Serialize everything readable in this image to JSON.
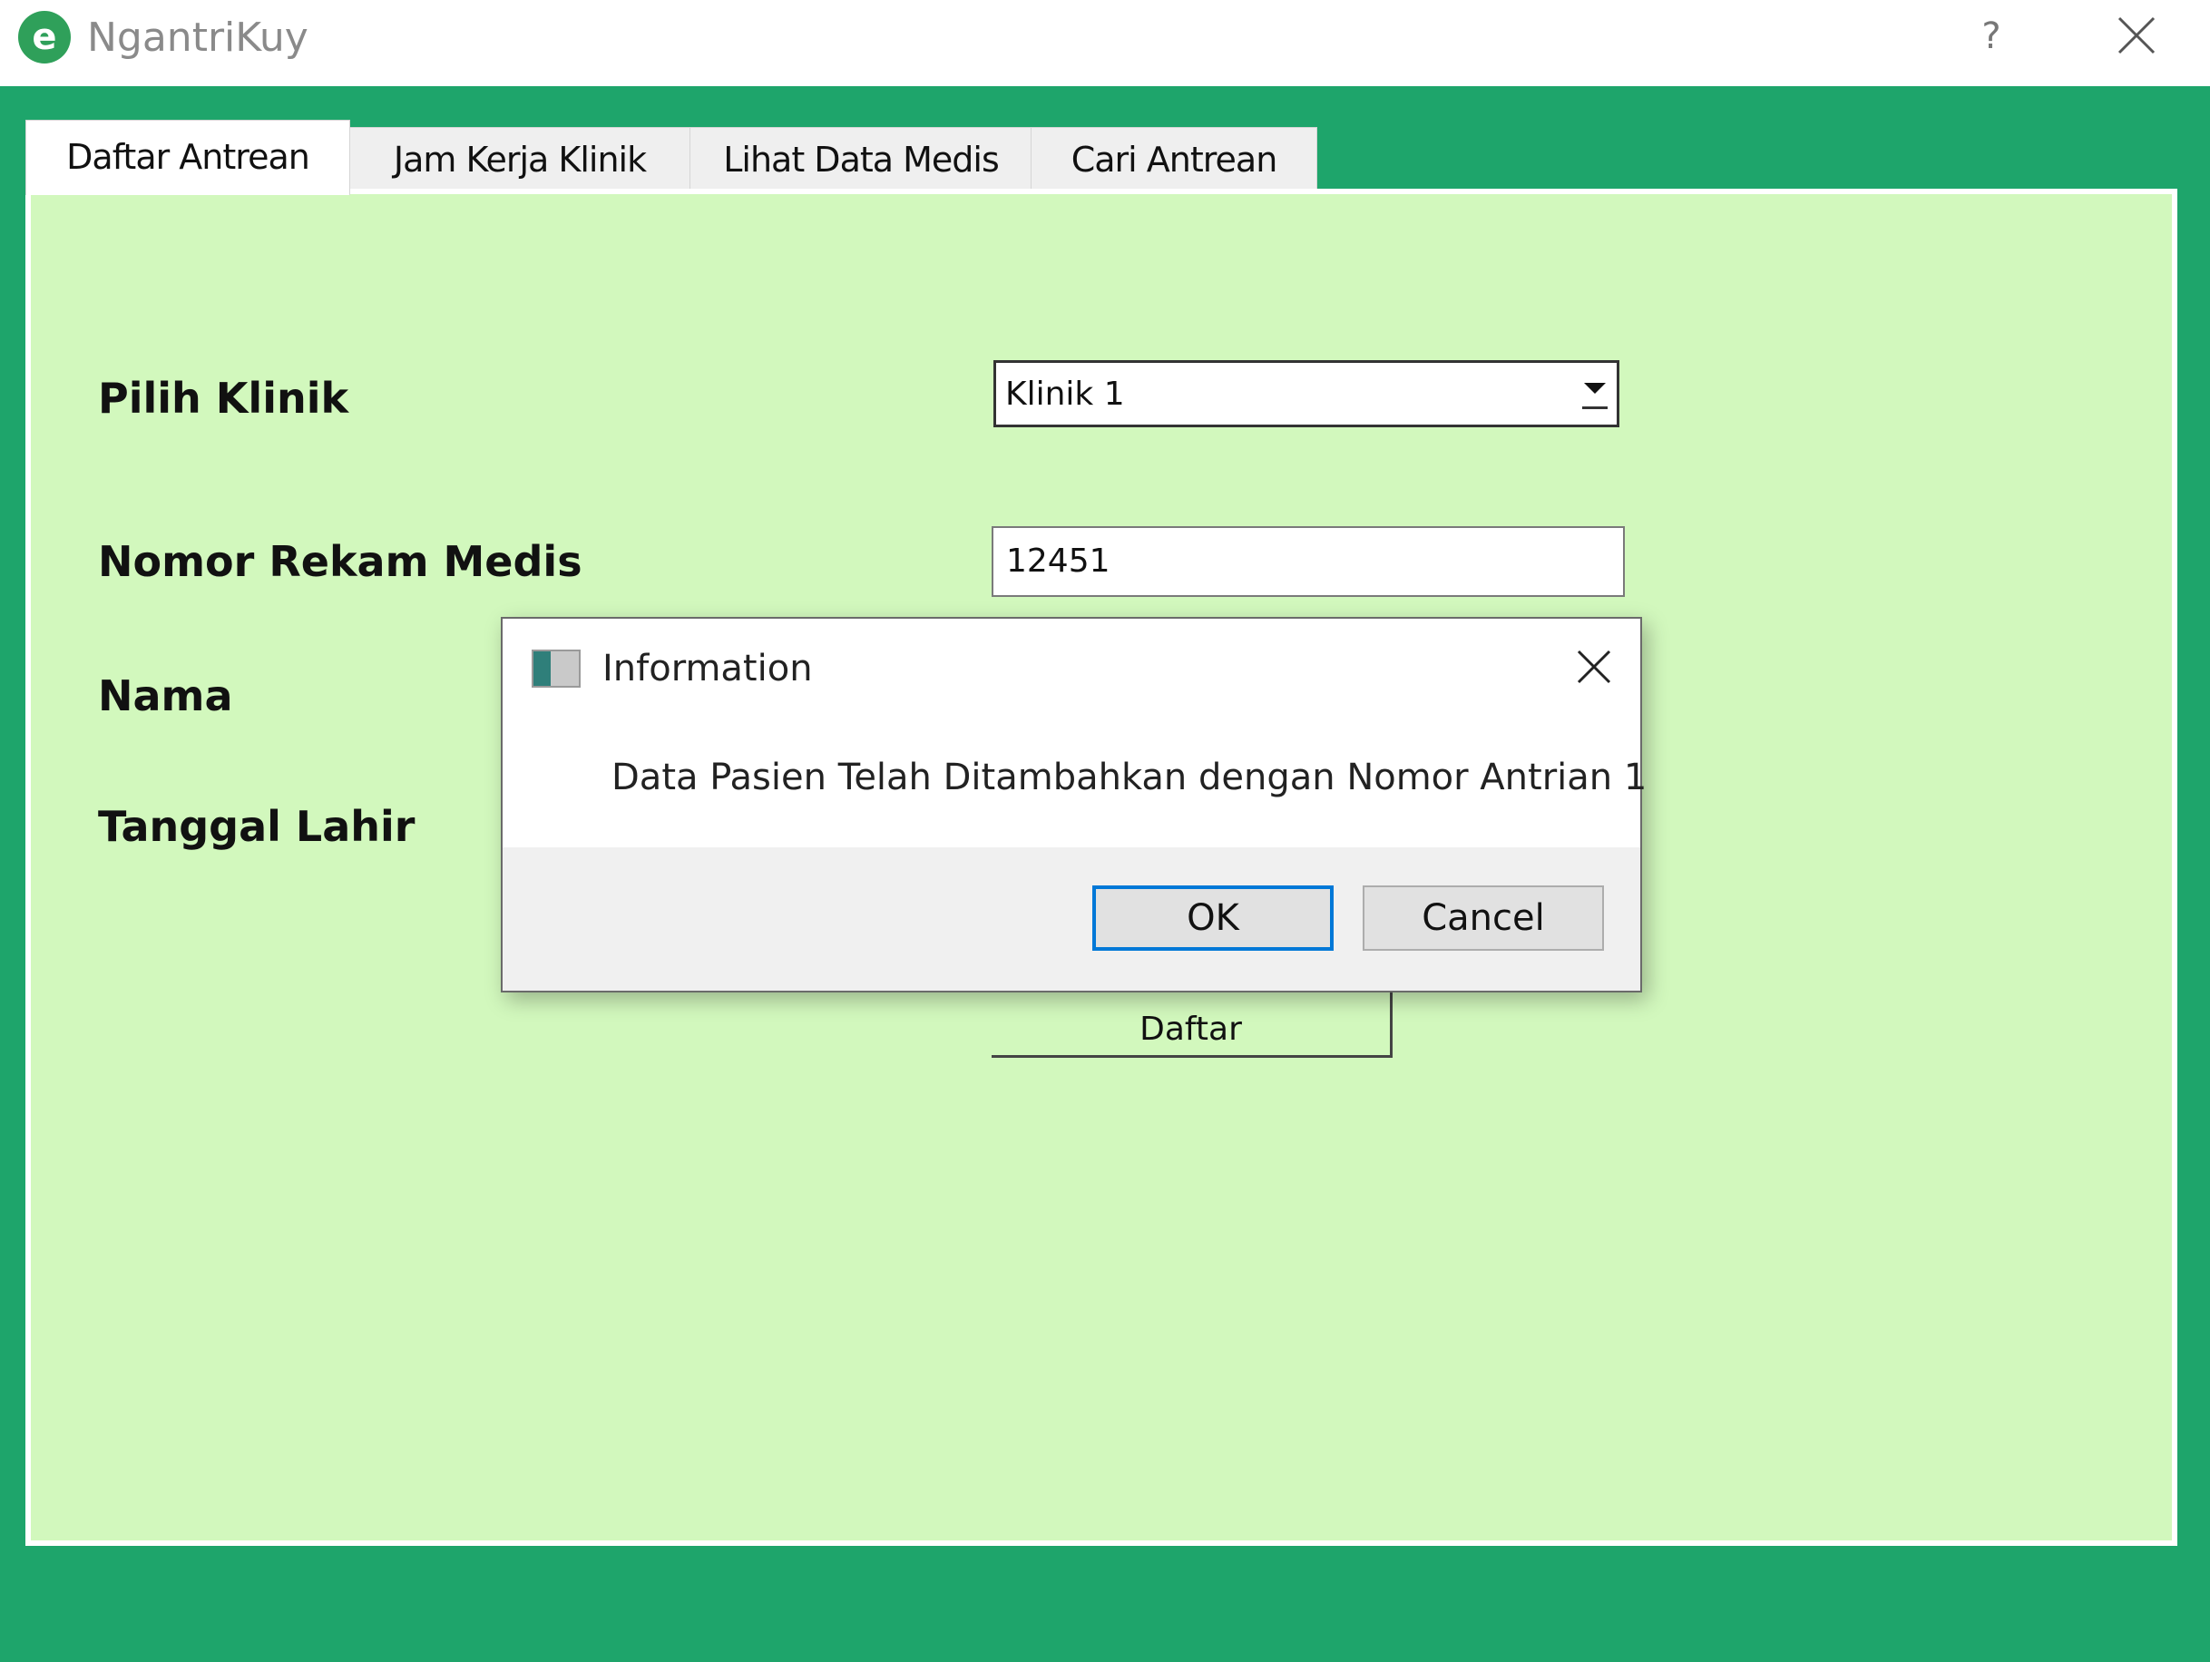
{
  "window": {
    "title": "NgantriKuy",
    "help_label": "?",
    "icon": "app-logo-icon",
    "icon_letter": "e",
    "close_icon": "close-icon"
  },
  "tabs": [
    {
      "label": "Daftar Antrean",
      "active": true
    },
    {
      "label": "Jam Kerja Klinik",
      "active": false
    },
    {
      "label": "Lihat Data Medis",
      "active": false
    },
    {
      "label": "Cari Antrean",
      "active": false
    }
  ],
  "form": {
    "klinik_label": "Pilih Klinik",
    "klinik_value": "Klinik 1",
    "rekam_medis_label": "Nomor Rekam Medis",
    "rekam_medis_value": "12451",
    "nama_label": "Nama",
    "tanggal_lahir_label": "Tanggal Lahir",
    "submit_label": "Daftar"
  },
  "dialog": {
    "title": "Information",
    "message": "Data Pasien Telah Ditambahkan dengan Nomor Antrian 1",
    "ok_label": "OK",
    "cancel_label": "Cancel"
  },
  "colors": {
    "frame": "#1ea56b",
    "panel": "#d2f8bd",
    "accent": "#0078d7"
  }
}
